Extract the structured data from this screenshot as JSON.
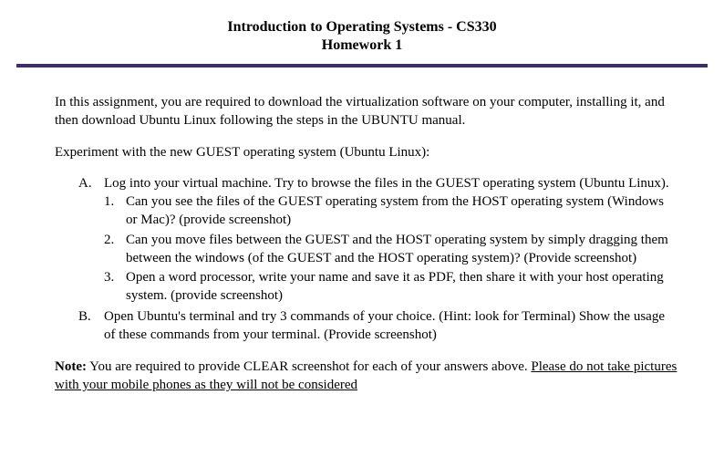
{
  "header": {
    "title_line1": "Introduction to Operating Systems - CS330",
    "title_line2": "Homework 1"
  },
  "body": {
    "intro": "In this assignment, you are required to download the virtualization software on your computer, installing it, and then download Ubuntu Linux following the steps in the UBUNTU manual.",
    "experiment": "Experiment with the new GUEST operating system (Ubuntu Linux):",
    "items": [
      {
        "marker": "A.",
        "text": "Log into your virtual machine. Try to browse the files in the GUEST operating system (Ubuntu Linux).",
        "subitems": [
          {
            "marker": "1.",
            "text": "Can you see the files of the GUEST operating system from the HOST operating system (Windows or Mac)? (provide screenshot)"
          },
          {
            "marker": "2.",
            "text": "Can you move files between the GUEST and the HOST operating system by simply dragging them between the windows (of the GUEST and the HOST operating system)? (Provide screenshot)"
          },
          {
            "marker": "3.",
            "text": "Open a word processor, write your name and save it as PDF, then share it with your host operating system. (provide screenshot)"
          }
        ]
      },
      {
        "marker": "B.",
        "text": "Open Ubuntu's terminal and try 3 commands of your choice. (Hint: look for Terminal) Show the usage of these commands from your terminal. (Provide screenshot)"
      }
    ],
    "note_label": "Note:",
    "note_text_plain": " You are required to provide CLEAR screenshot for each of your answers above. ",
    "note_text_underlined": "Please do not take pictures with your mobile phones as they will not be considered"
  }
}
